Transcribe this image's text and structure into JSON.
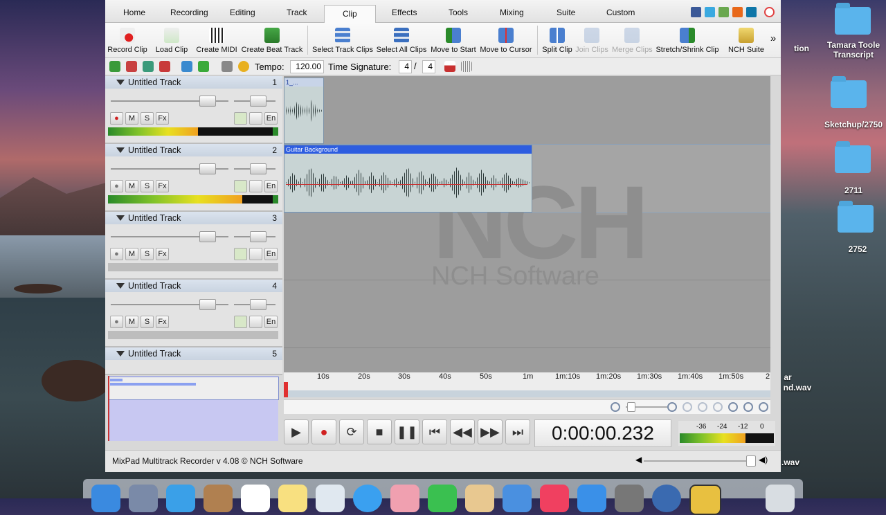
{
  "menu": {
    "items": [
      "Home",
      "Recording",
      "Editing",
      "Track",
      "Clip",
      "Effects",
      "Tools",
      "Mixing",
      "Suite",
      "Custom"
    ],
    "active": "Clip"
  },
  "toolbar": {
    "record_clip": "Record Clip",
    "load_clip": "Load Clip",
    "create_midi": "Create MIDI",
    "create_beat_track": "Create Beat Track",
    "select_track_clips": "Select Track Clips",
    "select_all_clips": "Select All Clips",
    "move_to_start": "Move to Start",
    "move_to_cursor": "Move to Cursor",
    "split_clip": "Split Clip",
    "join_clips": "Join Clips",
    "merge_clips": "Merge Clips",
    "stretch_shrink_clip": "Stretch/Shrink Clip",
    "nch_suite": "NCH Suite",
    "more": "»"
  },
  "toolbar2": {
    "tempo_label": "Tempo:",
    "tempo_value": "120.00",
    "time_sig_label": "Time Signature:",
    "time_sig_num": "4",
    "time_sig_slash": "/",
    "time_sig_den": "4"
  },
  "tracks": [
    {
      "name": "Untitled Track",
      "number": "1",
      "level": 0.53
    },
    {
      "name": "Untitled Track",
      "number": "2",
      "level": 0.79
    },
    {
      "name": "Untitled Track",
      "number": "3",
      "level": 0
    },
    {
      "name": "Untitled Track",
      "number": "4",
      "level": 0
    },
    {
      "name": "Untitled Track",
      "number": "5",
      "level": 0
    }
  ],
  "track_buttons": {
    "mute": "M",
    "solo": "S",
    "fx": "Fx",
    "en": "En"
  },
  "clips": [
    {
      "label": "1_..."
    },
    {
      "label": "Guitar Background"
    }
  ],
  "watermark": {
    "logo": "NCH",
    "text": "NCH Software"
  },
  "ruler": [
    "10s",
    "20s",
    "30s",
    "40s",
    "50s",
    "1m",
    "1m:10s",
    "1m:20s",
    "1m:30s",
    "1m:40s",
    "1m:50s",
    "2"
  ],
  "transport": {
    "time": "0:00:00.232"
  },
  "vu_labels": [
    "-36",
    "-24",
    "-12",
    "0"
  ],
  "status": {
    "text": "MixPad Multitrack Recorder v 4.08 © NCH Software"
  },
  "desktop": {
    "items": [
      "Tamara Toole Transcript",
      "Sketchup/2750",
      "2711",
      "2752"
    ],
    "partial_labels": [
      "tion",
      "ar",
      "nd.wav",
      ".wav"
    ]
  },
  "colors": {
    "clip_header": "#2d5de0",
    "accent": "#5ab4ec"
  }
}
